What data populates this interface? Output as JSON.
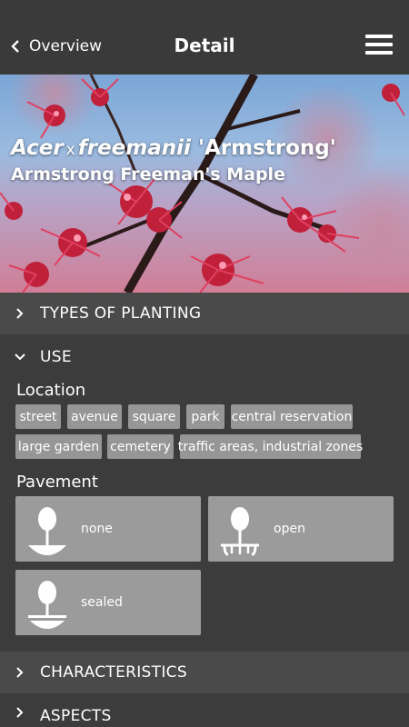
{
  "header": {
    "back_label": "Overview",
    "title": "Detail"
  },
  "hero": {
    "genus": "Acer",
    "hybrid_mark": "x",
    "species": "freemanii",
    "cultivar": "'Armstrong'",
    "common_name": "Armstrong Freeman's Maple"
  },
  "sections": {
    "types_of_planting": "TYPES OF PLANTING",
    "use": "USE",
    "characteristics": "CHARACTERISTICS",
    "aspects": "ASPECTS"
  },
  "use": {
    "location_title": "Location",
    "locations": [
      "street",
      "avenue",
      "square",
      "park",
      "central reservation",
      "large garden",
      "cemetery",
      "traffic areas, industrial zones"
    ],
    "pavement_title": "Pavement",
    "pavements": [
      "none",
      "open",
      "sealed"
    ]
  },
  "colors": {
    "topbar": "#3a3a3a",
    "section_header": "#4a4a4a",
    "content_bg": "#3c3c3c",
    "tag_bg": "#969696",
    "card_bg": "#9b9b9b"
  }
}
